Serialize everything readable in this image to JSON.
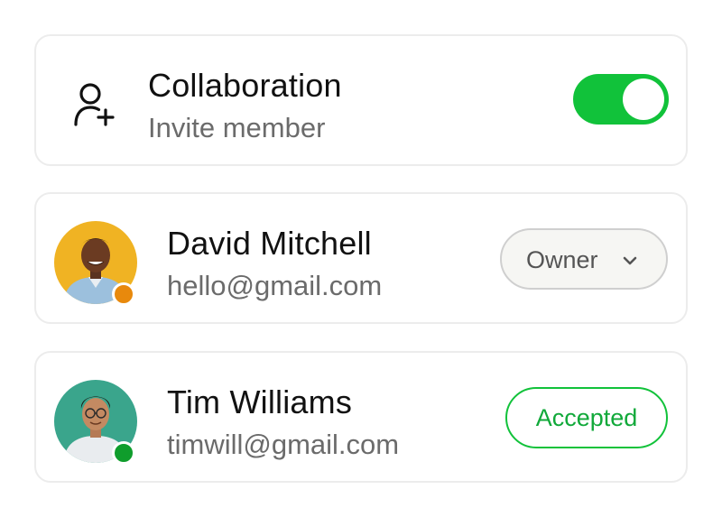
{
  "collaboration": {
    "title": "Collaboration",
    "subtitle": "Invite member",
    "icon": "user-plus-icon",
    "toggle_on": true,
    "toggle_color": "#11c23a"
  },
  "members": [
    {
      "name": "David Mitchell",
      "email": "hello@gmail.com",
      "avatar_bg": "#f0b323",
      "status_color": "#e8890c",
      "role": "Owner",
      "role_icon": "chevron-down-icon"
    },
    {
      "name": "Tim Williams",
      "email": "timwill@gmail.com",
      "avatar_bg": "#3aa58c",
      "status_color": "#0f9d2c",
      "status_badge": "Accepted",
      "badge_color": "#11c23a"
    }
  ]
}
